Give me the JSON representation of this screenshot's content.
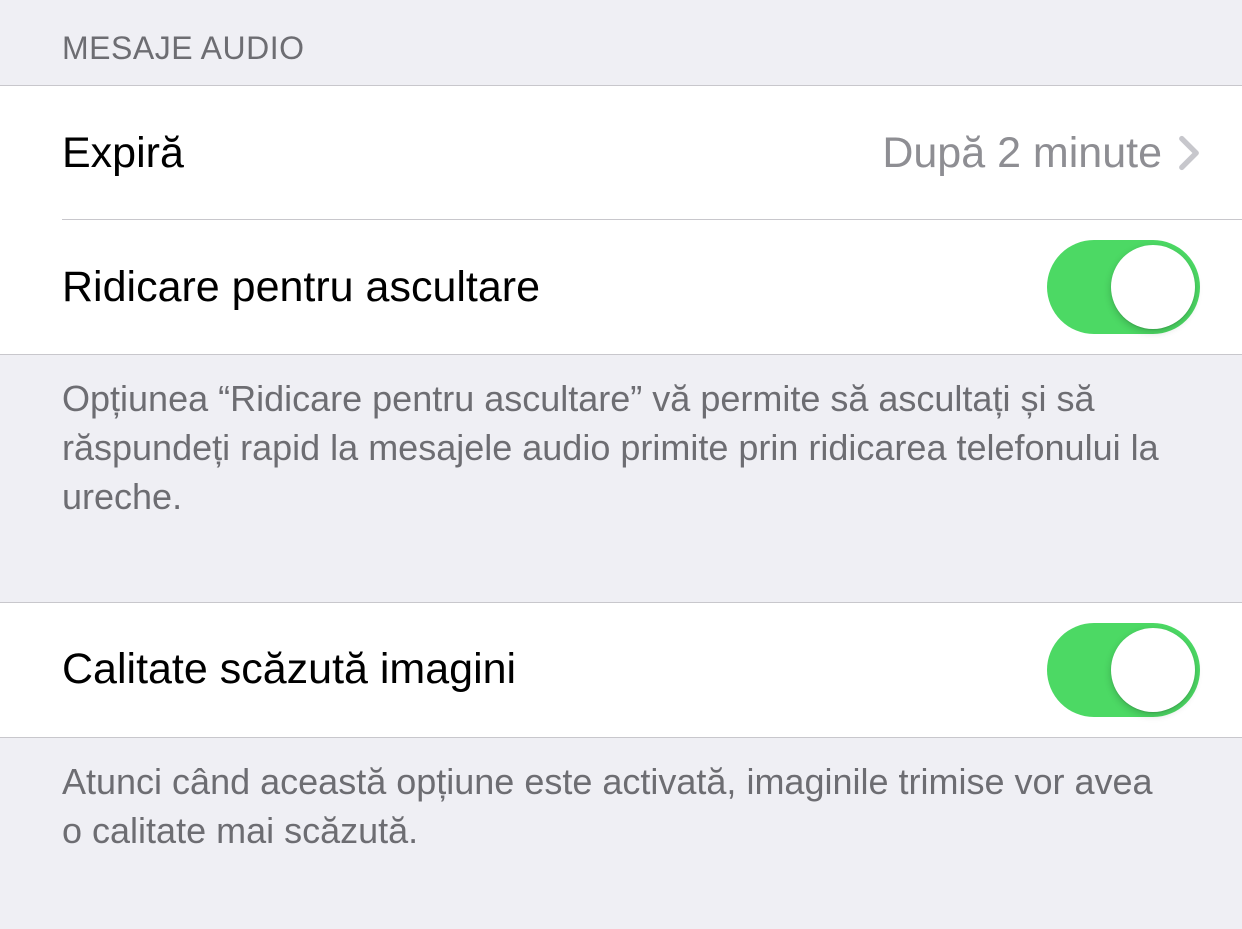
{
  "sections": {
    "audio": {
      "header": "Mesaje audio",
      "expire": {
        "label": "Expiră",
        "value": "După 2 minute"
      },
      "raiseToListen": {
        "label": "Ridicare pentru ascultare",
        "enabled": true
      },
      "footer": "Opțiunea “Ridicare pentru ascultare” vă permite să ascultați și să răspundeți rapid la mesajele audio primite prin ridicarea telefonului la ureche."
    },
    "images": {
      "lowQuality": {
        "label": "Calitate scăzută imagini",
        "enabled": true
      },
      "footer": "Atunci când această opțiune este activată, imaginile trimise vor avea o calitate mai scăzută."
    }
  }
}
